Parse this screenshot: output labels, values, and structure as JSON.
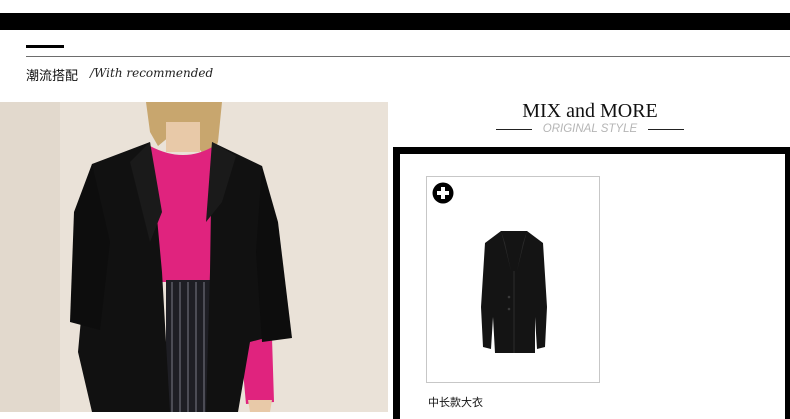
{
  "section": {
    "title": "潮流搭配",
    "subtitle": "/With recommended"
  },
  "mix": {
    "title": "MIX and MORE",
    "subtitle": "ORIGINAL STYLE"
  },
  "products": [
    {
      "name": "中长款大衣",
      "icon": "plus-circle-icon"
    }
  ],
  "colors": {
    "bar": "#000000",
    "sweater": "#e0237e",
    "coat": "#111111",
    "background": "#ece4da"
  }
}
